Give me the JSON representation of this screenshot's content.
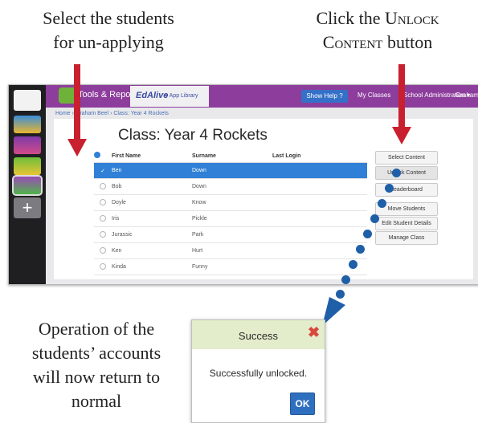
{
  "captions": {
    "left": [
      "Select the students",
      "for un-applying"
    ],
    "right_line1_pre": "Click the ",
    "right_line1_sc": "Unlock",
    "right_line2_sc": "Content",
    "right_line2_post": " button",
    "bottom": [
      "Operation of the",
      "students’ accounts",
      "will now return to",
      "normal"
    ]
  },
  "app": {
    "nav": {
      "tools_reports": "Tools & Reports",
      "edalive": "EdAlive",
      "app_library": "≡ App Library",
      "show_help": "Show Help ?",
      "my_classes": "My Classes",
      "school_admin": "School Administration ▾",
      "user": "Graham"
    },
    "breadcrumb": "Home › Graham Beel › Class: Year 4 Rockets",
    "class_title": "Class: Year 4 Rockets",
    "table": {
      "headers": [
        "First Name",
        "Surname",
        "Last Login"
      ],
      "rows": [
        {
          "first": "Ben",
          "surname": "Down",
          "last_login": "",
          "selected": true
        },
        {
          "first": "Bob",
          "surname": "Down",
          "last_login": "",
          "selected": false
        },
        {
          "first": "Doyle",
          "surname": "Know",
          "last_login": "",
          "selected": false
        },
        {
          "first": "Iris",
          "surname": "Pickle",
          "last_login": "",
          "selected": false
        },
        {
          "first": "Jurassic",
          "surname": "Park",
          "last_login": "",
          "selected": false
        },
        {
          "first": "Ken",
          "surname": "Hurt",
          "last_login": "",
          "selected": false
        },
        {
          "first": "Kinda",
          "surname": "Funny",
          "last_login": "",
          "selected": false
        }
      ]
    },
    "side_buttons": [
      "Select Content",
      "Unlock Content",
      "Leaderboard",
      "Move Students",
      "Edit Student Details",
      "Manage Class"
    ]
  },
  "dialog": {
    "title": "Success",
    "message": "Successfully unlocked.",
    "ok": "OK"
  },
  "colors": {
    "arrow": "#c8202f",
    "dots": "#1f5fa8",
    "topbar": "#8d3d9c",
    "selection": "#2f80d6"
  }
}
